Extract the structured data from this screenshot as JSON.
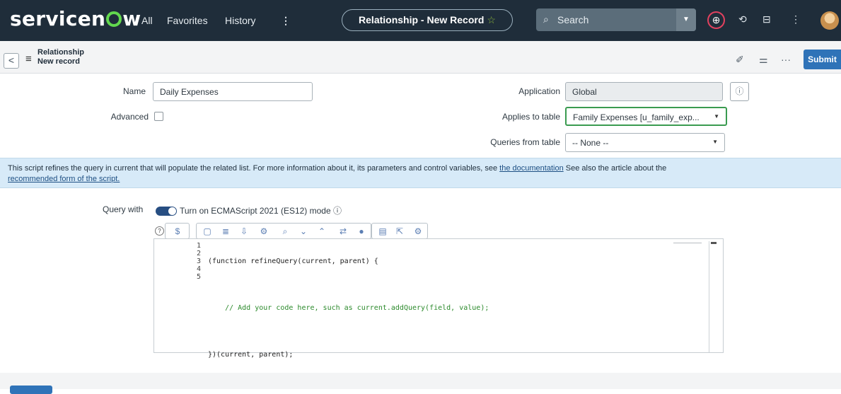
{
  "topbar": {
    "brand": "servicenow",
    "nav": [
      "All",
      "Favorites",
      "History",
      "⋮"
    ],
    "record_pill": "Relationship - New Record",
    "search_placeholder": "Search",
    "brand_color": "#62d84e",
    "bar_color": "#1f2d3a"
  },
  "header": {
    "title": "Relationship",
    "subtitle": "New record",
    "submit_label": "Submit"
  },
  "form": {
    "name_label": "Name",
    "name_value": "Daily Expenses",
    "advanced_label": "Advanced",
    "advanced_checked": false,
    "application_label": "Application",
    "application_value": "Global",
    "applies_to_label": "Applies to table",
    "applies_to_value": "Family Expenses [u_family_exp...",
    "queries_from_label": "Queries from table",
    "queries_from_value": "-- None --"
  },
  "banner": {
    "text": "This script refines the query in current that will populate the related list. For more information about it, its parameters and control variables, see",
    "link1": "the documentation",
    "text2": "See also the article about the",
    "link2": "recommended form of the script."
  },
  "query": {
    "label": "Query with",
    "toggle_on": true,
    "toggle_label": "Turn on ECMAScript 2021 (ES12) mode"
  },
  "editor": {
    "line_numbers": [
      "1",
      "2",
      "3",
      "4",
      "5"
    ],
    "lines": [
      "(function refineQuery(current, parent) {",
      "",
      "    // Add your code here, such as current.addQuery(field, value);",
      "",
      "})(current, parent);"
    ]
  }
}
